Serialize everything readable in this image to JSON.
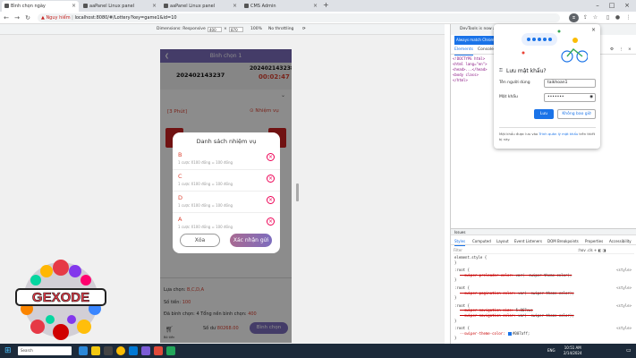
{
  "tabs": [
    {
      "label": "Bình chọn ngày",
      "active": true
    },
    {
      "label": "aaPanel Linux panel",
      "active": false
    },
    {
      "label": "aaPanel Linux panel",
      "active": false
    },
    {
      "label": "CMS Admin",
      "active": false
    }
  ],
  "address": {
    "warning": "Nguy hiểm",
    "url": "localhost:8080/#/Lottery?key=game1&id=10"
  },
  "devtoolbar": {
    "dimensions_label": "Dimensions: Responsive",
    "width": "400",
    "height": "870",
    "zoom": "100%",
    "throttle": "No throttling"
  },
  "phone": {
    "header_title": "Bình chọn 1",
    "round_id_left": "202402143237",
    "round_id_right": "202402143238",
    "timer": "00:02:47",
    "tag": "[3 Phút]",
    "mission_label": "Nhiệm vụ",
    "bottom": {
      "selection_label": "Lựa chọn:",
      "selection_value": "B,C,D,A",
      "amount_label": "Số tiền:",
      "amount_value": "100",
      "chosen_label": "Đã bình chọn: 4",
      "total_label": "Tổng nền bình chọn:",
      "total_value": "400",
      "cart_label": "Bỏ tiền",
      "balance_label": "Số dư",
      "balance_value": "80268.00",
      "vote_button": "Bình chọn"
    }
  },
  "modal": {
    "title": "Danh sách nhiệm vụ",
    "items": [
      {
        "letter": "B",
        "desc": "1 cược X100 đồng = 100 đồng"
      },
      {
        "letter": "C",
        "desc": "1 cược X100 đồng = 100 đồng"
      },
      {
        "letter": "D",
        "desc": "1 cược X100 đồng = 100 đồng"
      },
      {
        "letter": "A",
        "desc": "1 cược X100 đồng = 100 đồng"
      }
    ],
    "clear_button": "Xóa",
    "confirm_button": "Xác nhận gửi"
  },
  "logo": {
    "text": "GEXODE"
  },
  "devtools": {
    "notice": "DevTools is now available in ...",
    "always_match": "Always match Chrome's language",
    "tabs": [
      "Elements",
      "Console",
      "Sources"
    ],
    "dom": [
      "<!DOCTYPE html>",
      "<html lang=\"en\">",
      "<head>...</head>",
      "<body class>",
      "</html>"
    ],
    "console_label": "Issues",
    "styles_tabs": [
      "Styles",
      "Computed",
      "Layout",
      "Event Listeners",
      "DOM Breakpoints",
      "Properties",
      "Accessibility"
    ],
    "filter_placeholder": "Filter",
    "filter_hov": ":hov .cls + ◧ ◨",
    "rules": [
      {
        "selector": "element.style {",
        "props": [],
        "source": ""
      },
      {
        "selector": ":root {",
        "props": [
          {
            "name": "--swiper-preloader-color:",
            "value": "var(--swiper-theme-color);",
            "on": false
          }
        ],
        "source": "<style>"
      },
      {
        "selector": ":root {",
        "props": [
          {
            "name": "--swiper-pagination-color:",
            "value": "var(--swiper-theme-color);",
            "on": false
          }
        ],
        "source": "<style>"
      },
      {
        "selector": ":root {",
        "props": [
          {
            "name": "--swiper-navigation-size:",
            "value": "5.867vw;",
            "on": false
          },
          {
            "name": "--swiper-navigation-color:",
            "value": "var(--swiper-theme-color);",
            "on": false
          }
        ],
        "source": "<style>"
      },
      {
        "selector": ":root {",
        "props": [
          {
            "name": "--swiper-theme-color:",
            "value": "#007aff;",
            "on": true
          }
        ],
        "source": "<style>"
      },
      {
        "selector": "html {",
        "props": [],
        "source": "<style>"
      }
    ]
  },
  "password_popup": {
    "title": "Lưu mật khẩu?",
    "username_label": "Tên người dùng",
    "username_value": "taikhoan1",
    "password_label": "Mật khẩu",
    "password_value": "•••••••",
    "save_button": "Lưu",
    "never_button": "Không bao giờ",
    "note_prefix": "Mật khẩu được lưu vào",
    "note_link": "Trình quản lý mật khẩu",
    "note_suffix": "trên thiết bị này."
  },
  "taskbar": {
    "search_placeholder": "Search",
    "lang": "ENG",
    "time": "10:51 AM",
    "date": "2/14/2024"
  },
  "colors": {
    "accent": "#7d6dbe",
    "danger": "#dd4433",
    "devtools_blue": "#1a73e8"
  }
}
